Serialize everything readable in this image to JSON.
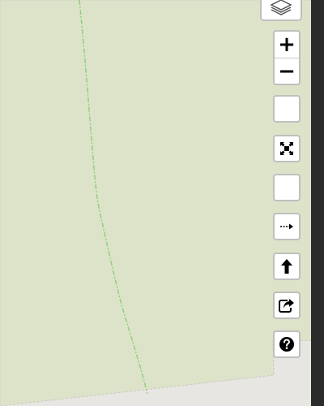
{
  "map": {
    "land_color": "#dde3c9",
    "background_color": "#e8e6e2",
    "boundary_color": "#8ed17b"
  },
  "controls": {
    "layers": {
      "icon": "layers-icon"
    },
    "zoom_in": {
      "label": "+",
      "icon": "plus-icon"
    },
    "zoom_out": {
      "label": "−",
      "icon": "minus-icon"
    },
    "blank_1": {
      "icon": "blank-icon"
    },
    "fullscreen": {
      "icon": "fullscreen-icon"
    },
    "blank_2": {
      "icon": "blank-icon"
    },
    "route": {
      "icon": "route-arrow-icon"
    },
    "locate": {
      "icon": "up-arrow-icon"
    },
    "share": {
      "icon": "share-icon"
    },
    "help": {
      "icon": "help-icon"
    }
  }
}
